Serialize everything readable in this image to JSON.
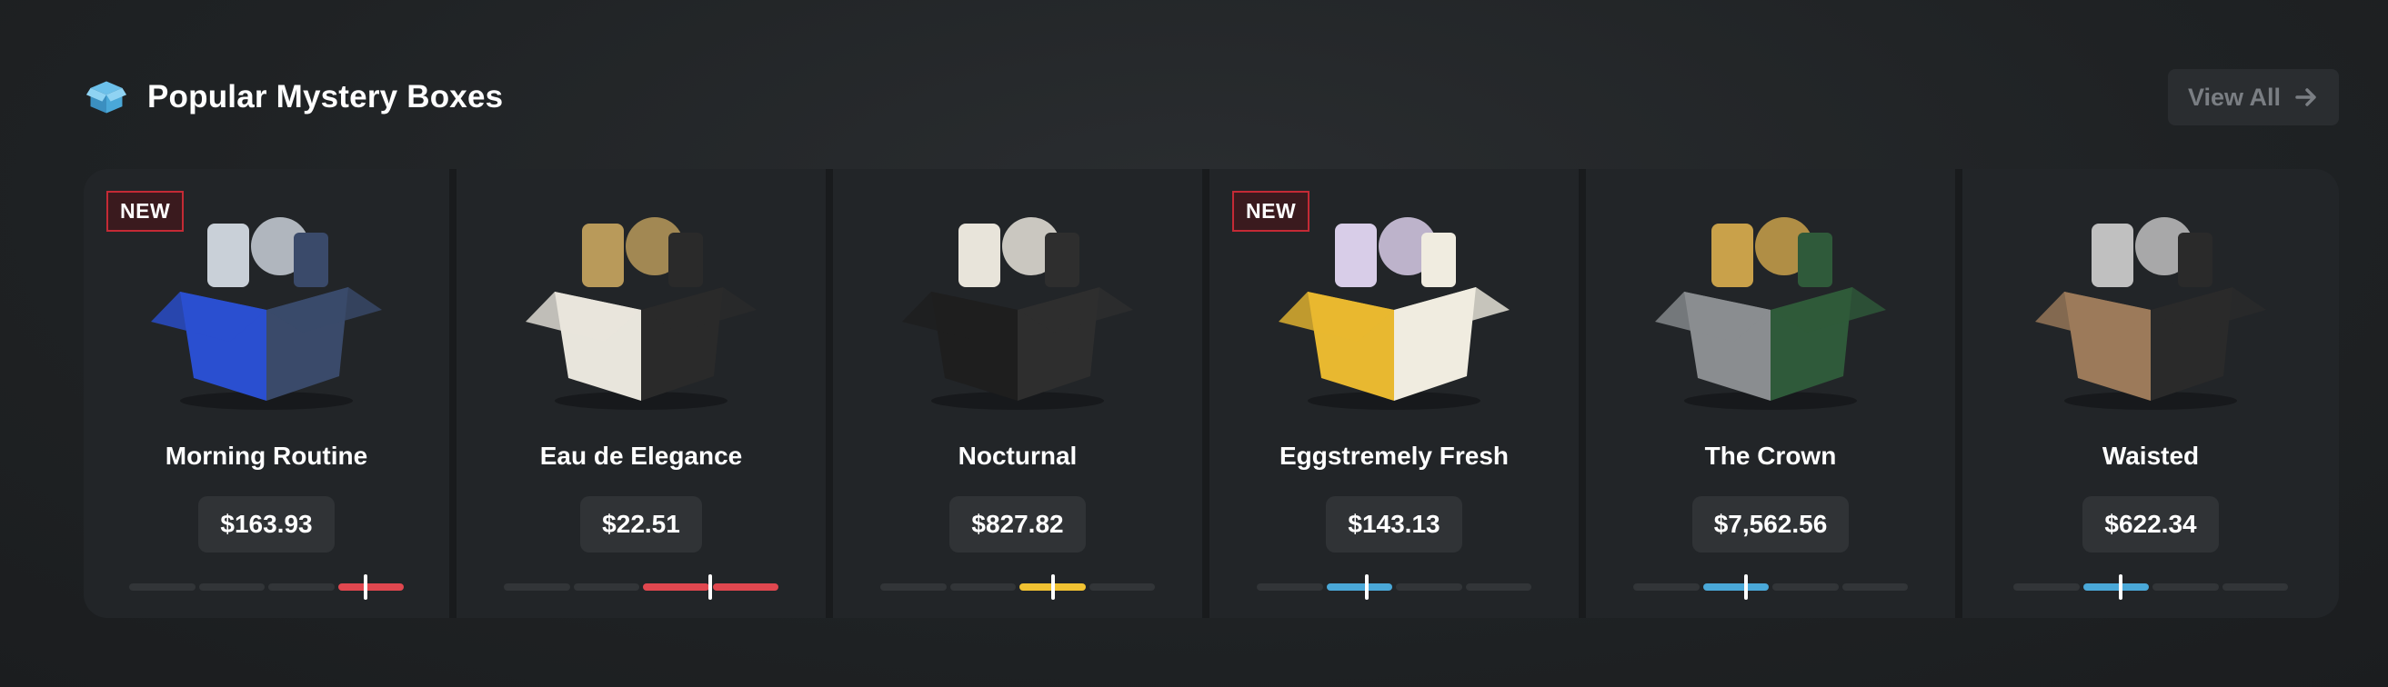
{
  "header": {
    "title": "Popular Mystery Boxes",
    "view_all_label": "View All",
    "icon": "box-icon",
    "icon_color": "#4aa8d8"
  },
  "cards": [
    {
      "name": "Morning Routine",
      "price": "$163.93",
      "badge": "NEW",
      "meter_level_pct": 86,
      "meter_color": "#e0474f",
      "colors": [
        "#2a4fd0",
        "#3a4a6a",
        "#c9d0d8"
      ]
    },
    {
      "name": "Eau de Elegance",
      "price": "$22.51",
      "badge": "",
      "meter_level_pct": 75,
      "meter_color": "#e0474f",
      "colors": [
        "#e8e5dc",
        "#2a2a2a",
        "#b99a5a"
      ]
    },
    {
      "name": "Nocturnal",
      "price": "$827.82",
      "badge": "",
      "meter_level_pct": 63,
      "meter_color": "#f1c232",
      "colors": [
        "#1e1e1e",
        "#2e2e2e",
        "#e8e4da"
      ]
    },
    {
      "name": "Eggstremely Fresh",
      "price": "$143.13",
      "badge": "NEW",
      "meter_level_pct": 40,
      "meter_color": "#4aa8d8",
      "colors": [
        "#e8b830",
        "#f0ece0",
        "#d8cde8"
      ]
    },
    {
      "name": "The Crown",
      "price": "$7,562.56",
      "badge": "",
      "meter_level_pct": 41,
      "meter_color": "#4aa8d8",
      "colors": [
        "#8a8d90",
        "#2f5a3a",
        "#c9a14a"
      ]
    },
    {
      "name": "Waisted",
      "price": "$622.34",
      "badge": "",
      "meter_level_pct": 39,
      "meter_color": "#4aa8d8",
      "colors": [
        "#9c7a5a",
        "#2a2a2a",
        "#c0c0c0"
      ]
    }
  ]
}
